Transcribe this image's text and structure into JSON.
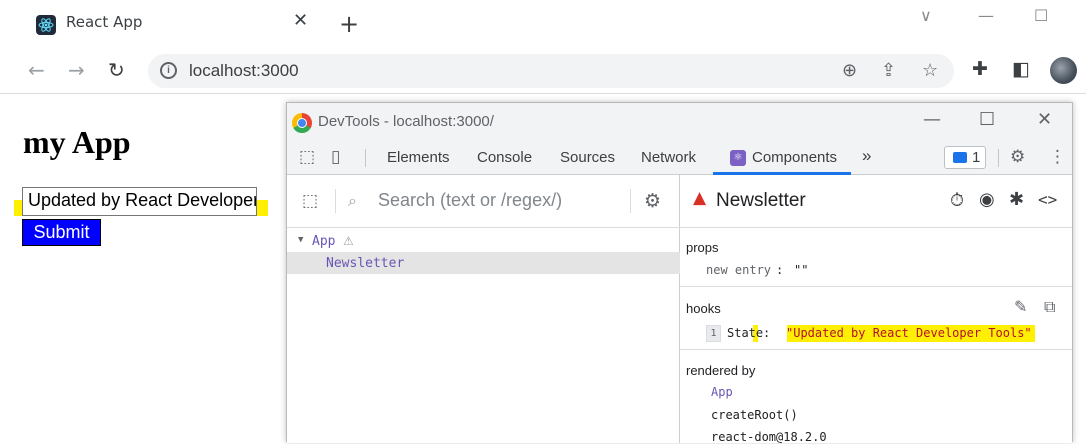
{
  "browser": {
    "tab_title": "React App",
    "tab_close": "✕",
    "new_tab": "+",
    "url": "localhost:3000",
    "window_controls": [
      "∨",
      "—",
      "☐"
    ]
  },
  "page": {
    "heading": "my App",
    "input_value": "Updated by React Developer Tools",
    "submit_label": "Submit"
  },
  "devtools": {
    "window_title": "DevTools - localhost:3000/",
    "tabs": [
      "Elements",
      "Console",
      "Sources",
      "Network",
      "Components"
    ],
    "more_tabs": "»",
    "issues_count": "1",
    "tree": {
      "search_placeholder": "Search (text or /regex/)",
      "items": [
        {
          "label": "App",
          "depth": 0,
          "expanded": true,
          "warning": true
        },
        {
          "label": "Newsletter",
          "depth": 1,
          "selected": true
        }
      ]
    },
    "inspector": {
      "component_name": "Newsletter",
      "props_title": "props",
      "prop_key": "new entry",
      "prop_value": "\"\"",
      "hooks_title": "hooks",
      "hook_index": "1",
      "hook_name": "State",
      "hook_value": "\"Updated by React Developer Tools\"",
      "rendered_by_title": "rendered by",
      "rendered_by": [
        "App",
        "createRoot()",
        "react-dom@18.2.0"
      ]
    }
  },
  "colors": {
    "highlight": "#ffef00",
    "submit_bg": "#0000ff",
    "accent": "#1a73e8",
    "component_purple": "#6a55b4"
  }
}
